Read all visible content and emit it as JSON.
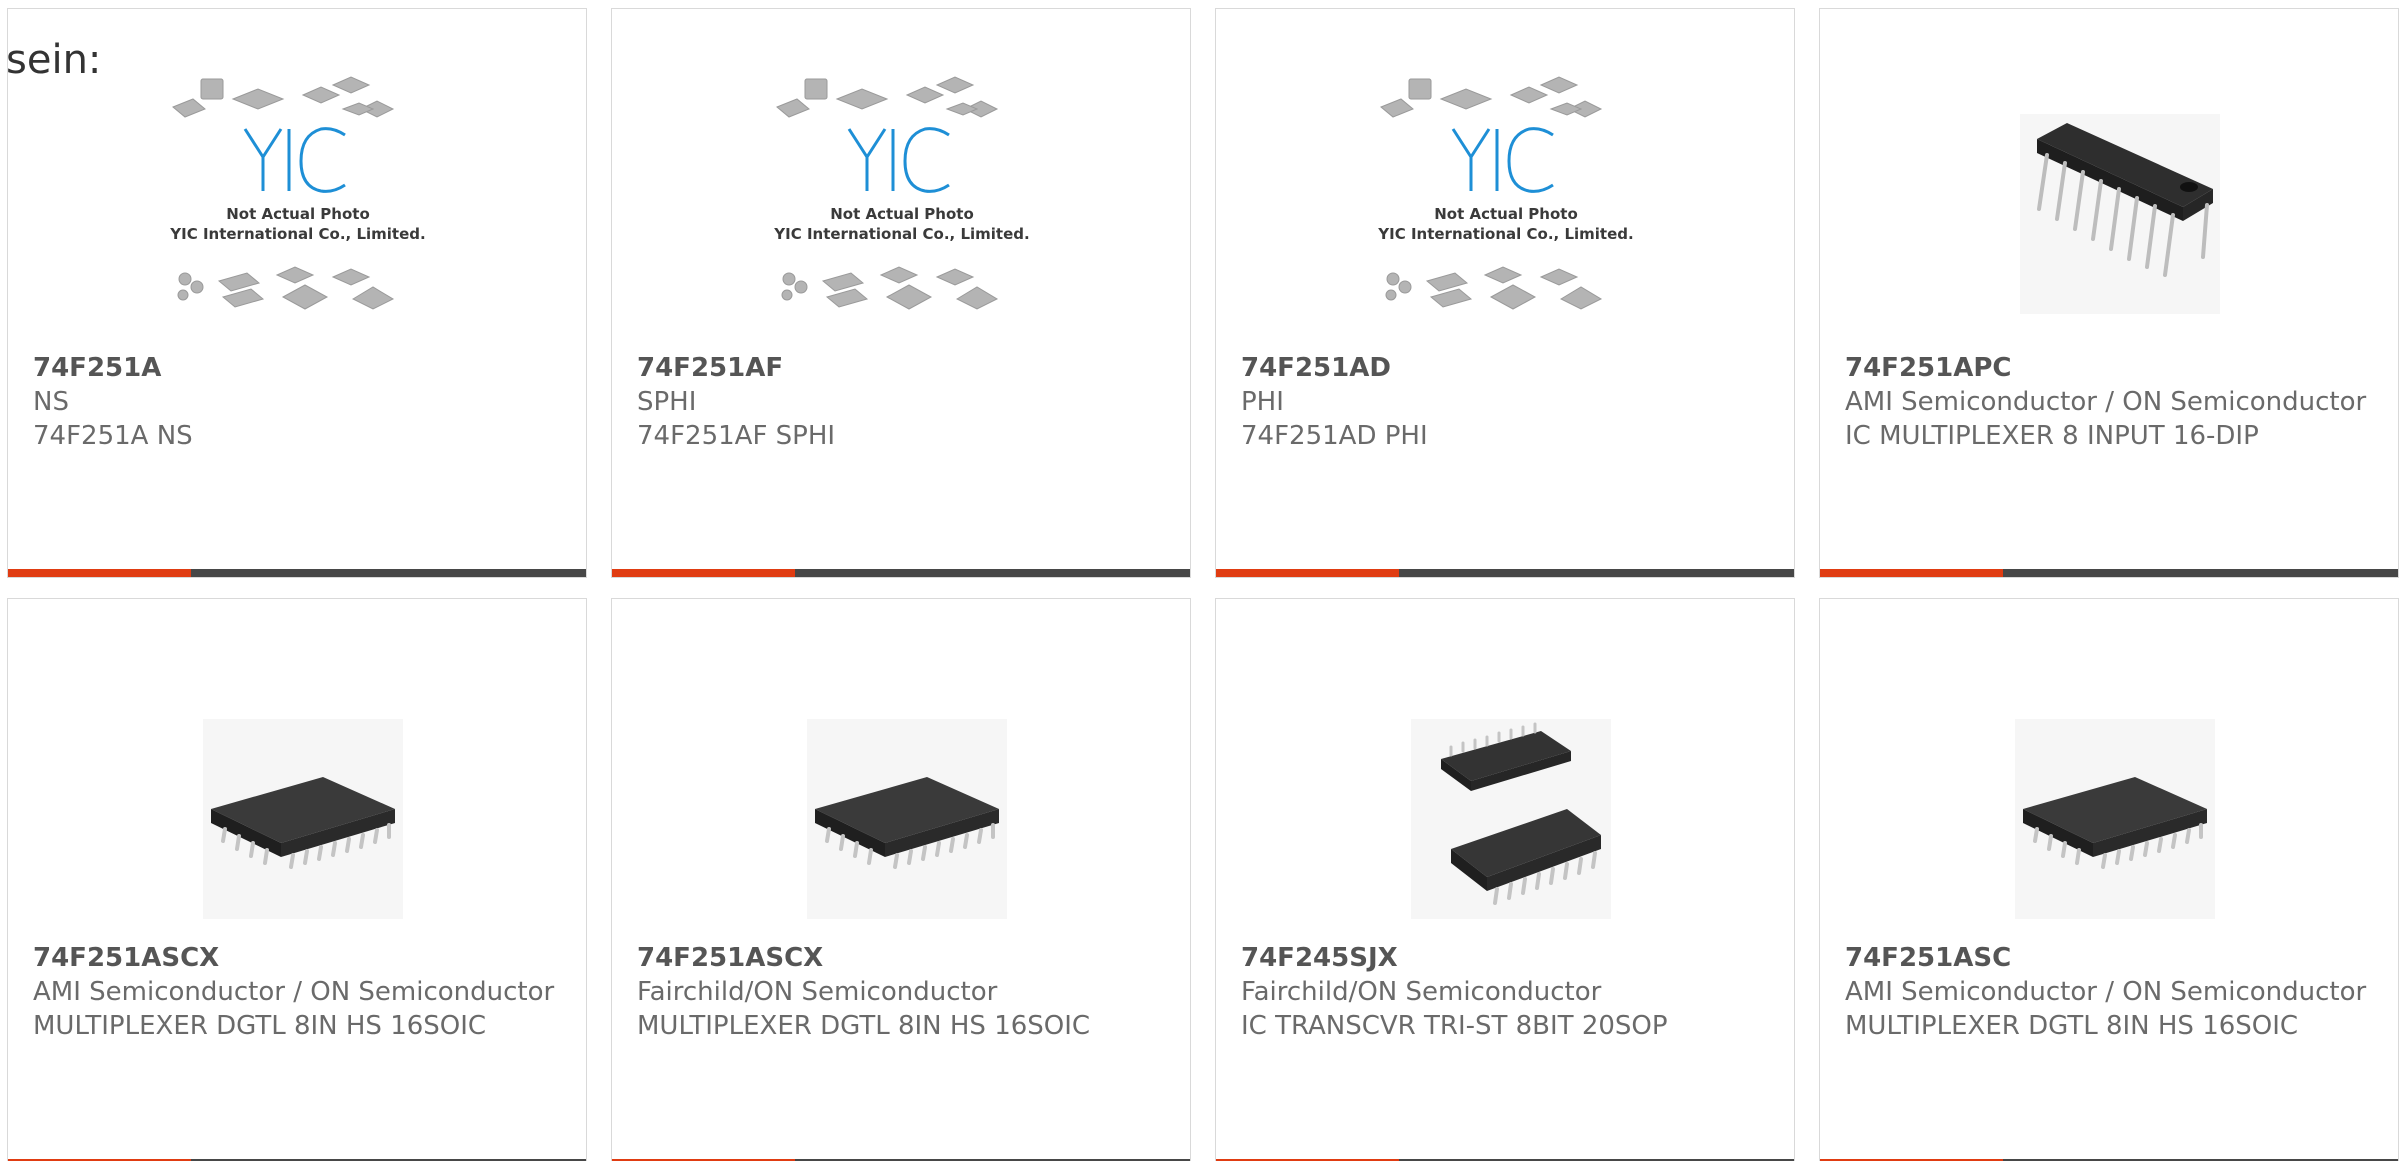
{
  "intro_text": "sein:",
  "products": [
    {
      "part": "74F251A",
      "maker": "NS",
      "desc": "74F251A NS",
      "image": "placeholder-photo"
    },
    {
      "part": "74F251AF",
      "maker": "SPHI",
      "desc": "74F251AF SPHI",
      "image": "placeholder-photo"
    },
    {
      "part": "74F251AD",
      "maker": "PHI",
      "desc": "74F251AD PHI",
      "image": "placeholder-photo"
    },
    {
      "part": "74F251APC",
      "maker": "AMI Semiconductor / ON Semiconductor",
      "desc": "IC MULTIPLEXER 8 INPUT 16-DIP",
      "image": "dip-chip"
    },
    {
      "part": "74F251ASCX",
      "maker": "AMI Semiconductor / ON Semiconductor",
      "desc": "MULTIPLEXER DGTL 8IN HS 16SOIC",
      "image": "soic-chip"
    },
    {
      "part": "74F251ASCX",
      "maker": "Fairchild/ON Semiconductor",
      "desc": "MULTIPLEXER DGTL 8IN HS 16SOIC",
      "image": "soic-chip"
    },
    {
      "part": "74F245SJX",
      "maker": "Fairchild/ON Semiconductor",
      "desc": "IC TRANSCVR TRI-ST 8BIT 20SOP",
      "image": "sop-chip-pair"
    },
    {
      "part": "74F251ASC",
      "maker": "AMI Semiconductor / ON Semiconductor",
      "desc": "MULTIPLEXER DGTL 8IN HS 16SOIC",
      "image": "soic-chip"
    }
  ],
  "placeholder": {
    "logo_text": "YIC",
    "line1": "Not Actual Photo",
    "line2": "YIC International Co., Limited."
  },
  "colors": {
    "accent": "#e03c12",
    "bar": "#474747",
    "border": "#d9d9d9",
    "logo": "#1e8fd6"
  }
}
